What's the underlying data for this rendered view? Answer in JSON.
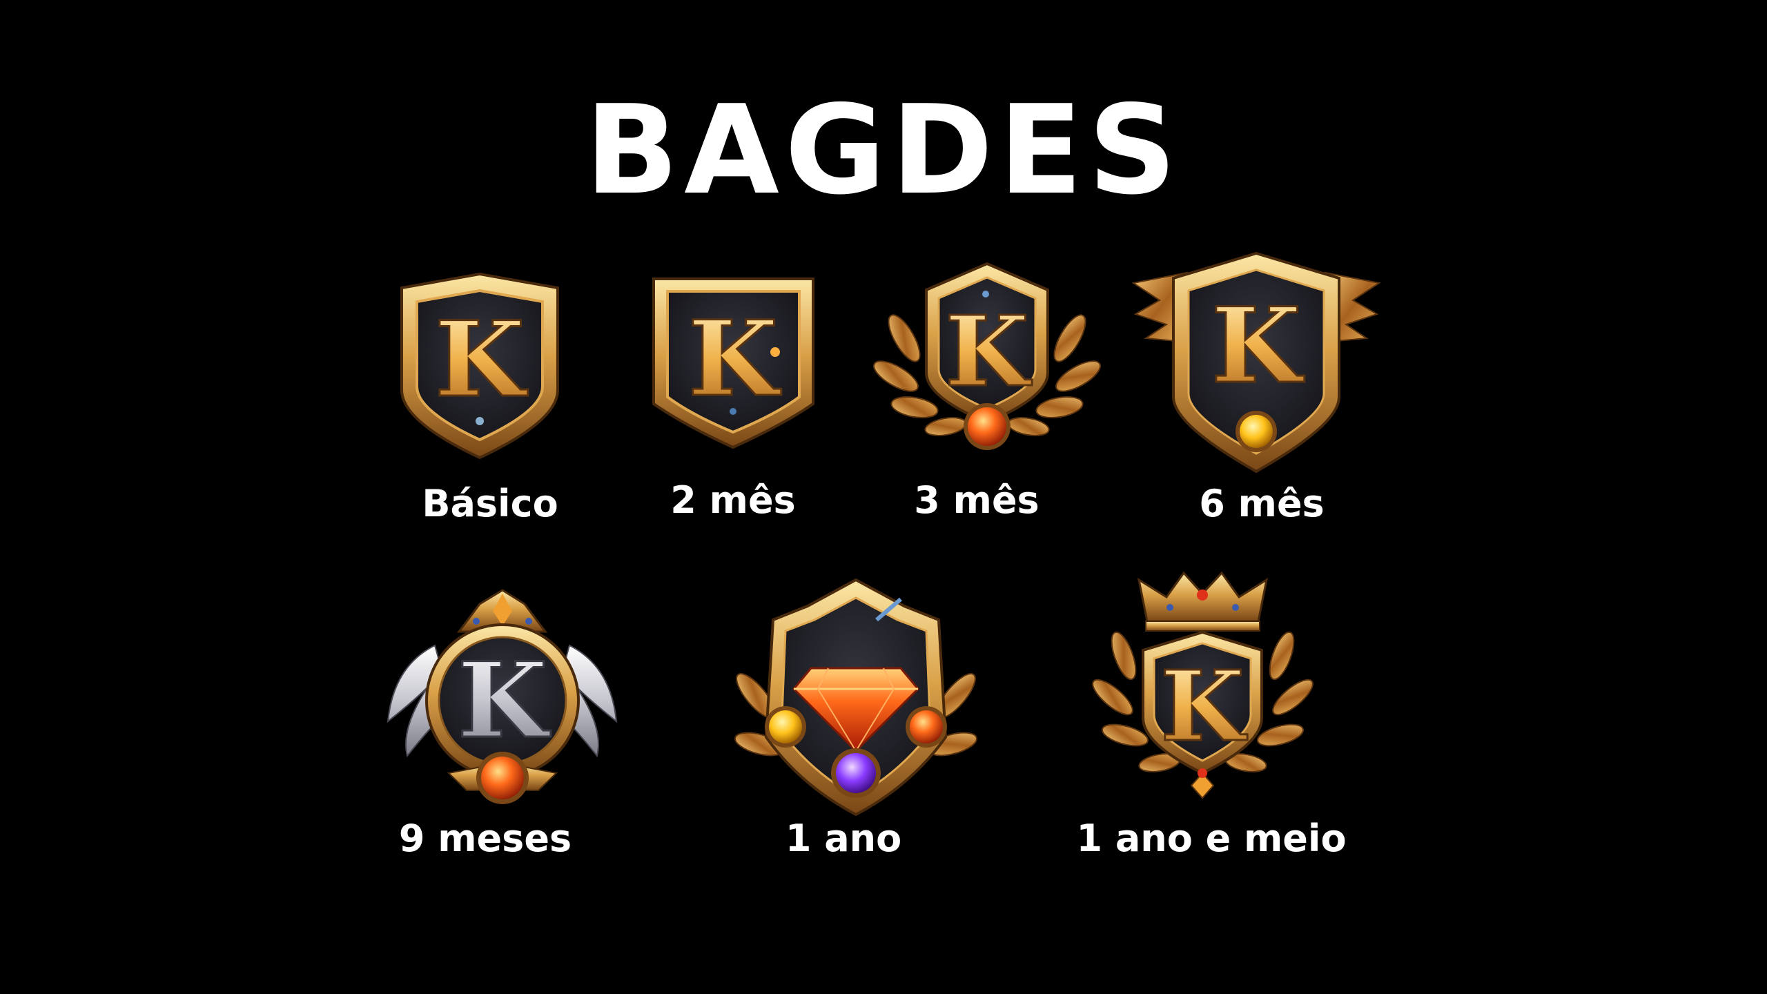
{
  "title": "BAGDES",
  "colors": {
    "background": "#000000",
    "gold_light": "#f6d27a",
    "gold": "#c98a2e",
    "bronze_dark": "#5a3310",
    "panel": "#1c1c22",
    "silver": "#d9d9df",
    "gem_orange": "#ff5a12",
    "gem_yellow": "#ffc21a",
    "gem_purple": "#8a3cff",
    "gem_red": "#e0321a"
  },
  "badges": [
    {
      "id": "basico",
      "label": "Básico",
      "icon": "shield-k-badge-icon"
    },
    {
      "id": "2-mes",
      "label": "2 mês",
      "icon": "square-shield-k-badge-icon"
    },
    {
      "id": "3-mes",
      "label": "3 mês",
      "icon": "laurel-k-badge-icon"
    },
    {
      "id": "6-mes",
      "label": "6 mês",
      "icon": "winged-shield-k-badge-icon"
    },
    {
      "id": "9-meses",
      "label": "9 meses",
      "icon": "crowned-silver-k-badge-icon"
    },
    {
      "id": "1-ano",
      "label": "1 ano",
      "icon": "diamond-gem-badge-icon"
    },
    {
      "id": "1-ano-e-meio",
      "label": "1 ano e meio",
      "icon": "crowned-laurel-k-badge-icon"
    }
  ]
}
